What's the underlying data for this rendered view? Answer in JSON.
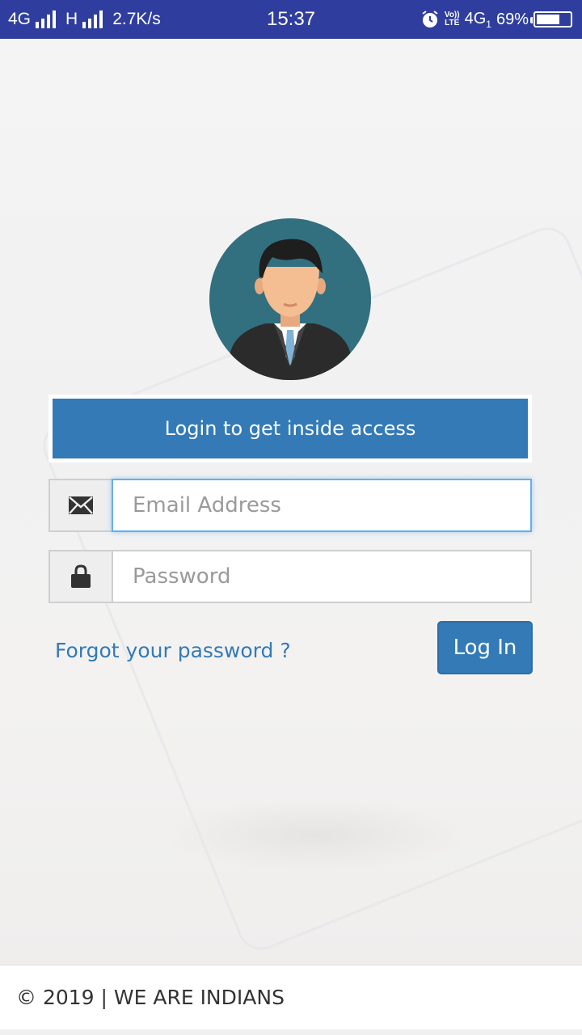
{
  "status_bar": {
    "network1": "4G",
    "network2": "H",
    "speed": "2.7K/s",
    "time": "15:37",
    "volte_top": "Vo))",
    "volte_bottom": "LTE",
    "network3": "4G",
    "sim": "1",
    "battery": "69%",
    "battery_level": 0.69,
    "color": "#2f3e9e"
  },
  "header": {
    "banner_text": "Login to get inside access"
  },
  "form": {
    "email_placeholder": "Email Address",
    "password_placeholder": "Password",
    "forgot_link": "Forgot your password ?",
    "login_button": "Log In"
  },
  "footer": {
    "text": "© 2019 | WE ARE INDIANS"
  },
  "icons": {
    "email": "envelope-icon",
    "password": "lock-icon",
    "avatar": "user-avatar-icon",
    "alarm": "alarm-icon"
  },
  "colors": {
    "primary": "#337ab7",
    "avatar_bg": "#326f7f",
    "focus_border": "#66afe9"
  }
}
